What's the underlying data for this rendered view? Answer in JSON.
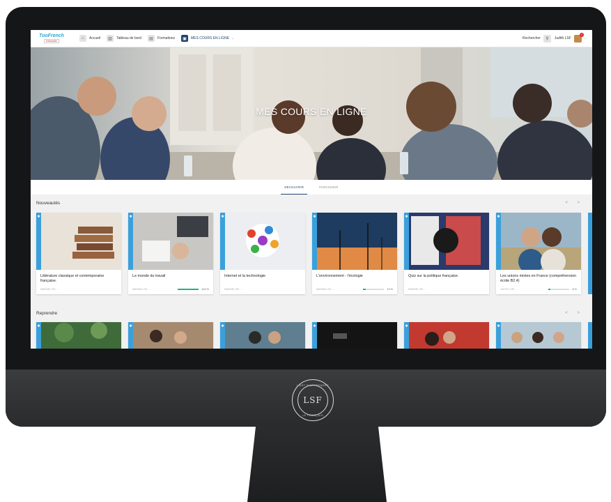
{
  "topbar": {
    "brand_name": "TooFrench",
    "brand_sub": "Kirkwalde",
    "nav": [
      {
        "label": "Accueil",
        "icon": "home-icon"
      },
      {
        "label": "Tableau de bord",
        "icon": "chart-icon"
      },
      {
        "label": "Formations",
        "icon": "book-icon"
      },
      {
        "label": "MES COURS EN LIGNE",
        "icon": "courses-icon"
      }
    ],
    "search_label": "Rechercher",
    "user_name": "Judith LSF",
    "notif_count": "3"
  },
  "hero": {
    "title": "MES COURS EN LIGNE"
  },
  "tabs": [
    {
      "label": "DÉCOUVRIR"
    },
    {
      "label": "PARCOURIR"
    }
  ],
  "sections": {
    "new_title": "Nouveautés",
    "resume_title": "Reprendre",
    "arrows": "< >"
  },
  "cards": [
    {
      "title": "Littérature classique et contemporaine française.",
      "author": "MARINE LSF, ...",
      "progress": null,
      "progress_label": ""
    },
    {
      "title": "Le monde du travail",
      "author": "MARINE LSF, ...",
      "progress": 100,
      "progress_label": "100 %"
    },
    {
      "title": "Internet et la technologie",
      "author": "MARINE LSF, ...",
      "progress": null,
      "progress_label": ""
    },
    {
      "title": "L'environnement - l'écologie",
      "author": "MARINE LSF, ...",
      "progress": 13,
      "progress_label": "13 %"
    },
    {
      "title": "Quiz sur la politique française.",
      "author": "MARINE LSF, ...",
      "progress": null,
      "progress_label": ""
    },
    {
      "title": "Les unions mixtes en France (compréhension écrite B2.4)",
      "author": "JUDITH LSF, ...",
      "progress": 8,
      "progress_label": "8 %"
    }
  ],
  "chin_logo": {
    "text": "LSF",
    "top": "L'ART D'APPRENDRE",
    "bottom": "LE FRANÇAIS"
  },
  "colors": {
    "accent": "#23436e",
    "card_band": "#3aa0dc",
    "progress": "#1db28e"
  }
}
